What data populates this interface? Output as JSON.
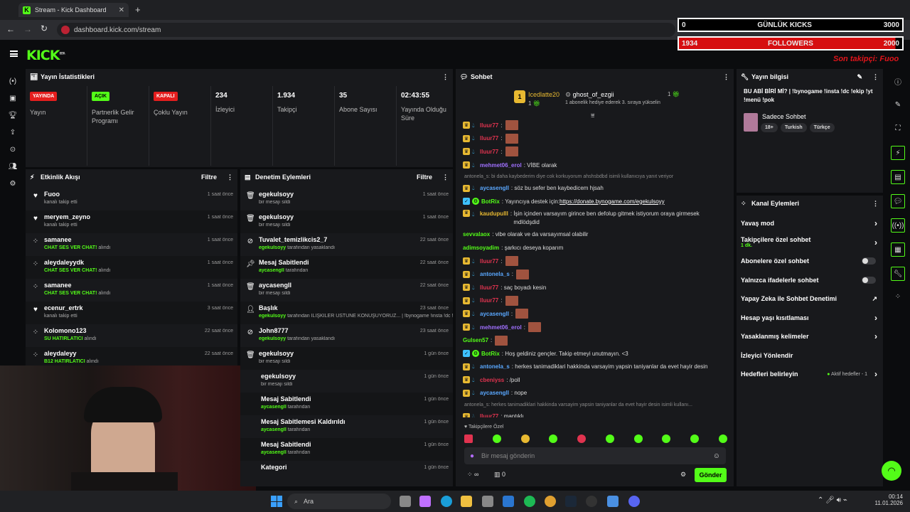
{
  "browser": {
    "tab_title": "Stream - Kick Dashboard",
    "url": "dashboard.kick.com/stream"
  },
  "brand": {
    "logo": "KICK",
    "logo_sup": "BETA",
    "accent": "#53fc18"
  },
  "overlay": {
    "kicks_left": "0",
    "kicks_label": "GÜNLÜK KICKS",
    "kicks_right": "3000",
    "followers_left": "1934",
    "followers_label": "FOLLOWERS",
    "followers_right": "2000",
    "last_follower": "Son takipçi: Fuoo"
  },
  "stats_panel": {
    "title": "Yayın İstatistikleri",
    "items": [
      {
        "badge": "YAYINDA",
        "label": "Yayın"
      },
      {
        "badge": "AÇIK",
        "label": "Partnerlik Gelir Programı"
      },
      {
        "badge": "KAPALI",
        "label": "Çoklu Yayın"
      },
      {
        "value": "234",
        "label": "İzleyici"
      },
      {
        "value": "1.934",
        "label": "Takipçi"
      },
      {
        "value": "35",
        "label": "Abone Sayısı"
      },
      {
        "value": "02:43:55",
        "label": "Yayında Olduğu Süre"
      }
    ]
  },
  "activity": {
    "title": "Etkinlik Akışı",
    "filter": "Filtre",
    "items": [
      {
        "icon": "heart-icon",
        "name": "Fuoo",
        "detail": "kanalı takip etti",
        "time": "1 saat önce"
      },
      {
        "icon": "heart-icon",
        "name": "meryem_zeyno",
        "detail": "kanalı takip etti",
        "time": "1 saat önce"
      },
      {
        "icon": "kicks-icon",
        "name": "samanee",
        "highlight": "CHAT SES VER CHAT!",
        "detail": "alındı",
        "time": "1 saat önce"
      },
      {
        "icon": "kicks-icon",
        "name": "aleydaleyydk",
        "highlight": "CHAT SES VER CHAT!",
        "detail": "alındı",
        "time": "1 saat önce"
      },
      {
        "icon": "kicks-icon",
        "name": "samanee",
        "highlight": "CHAT SES VER CHAT!",
        "detail": "alındı",
        "time": "1 saat önce"
      },
      {
        "icon": "heart-icon",
        "name": "ecenur_ertrk",
        "detail": "kanalı takip etti",
        "time": "3 saat önce"
      },
      {
        "icon": "kicks-icon",
        "name": "Kolomono123",
        "highlight": "SU HATIRLATICI",
        "detail": "alındı",
        "time": "22 saat önce"
      },
      {
        "icon": "kicks-icon",
        "name": "aleydaleyy",
        "highlight": "B12 HATIRLATICI",
        "detail": "alındı",
        "time": "22 saat önce"
      }
    ]
  },
  "moderation": {
    "title": "Denetim Eylemleri",
    "filter": "Filtre",
    "items": [
      {
        "icon": "trash-icon",
        "name": "egekulsoyy",
        "detail": "bir mesajı sildi",
        "time": "1 saat önce"
      },
      {
        "icon": "trash-icon",
        "name": "egekulsoyy",
        "detail": "bir mesajı sildi",
        "time": "1 saat önce"
      },
      {
        "icon": "ban-icon",
        "name": "Tuvalet_temizlikcis2_7",
        "highlight": "egekulsoyy",
        "detail": "tarafından yasaklandı",
        "time": "22 saat önce"
      },
      {
        "icon": "pin-icon",
        "name": "Mesaj Sabitlendi",
        "highlight": "aycasengll",
        "detail": "tarafından",
        "time": "22 saat önce"
      },
      {
        "icon": "trash-icon",
        "name": "aycasengll",
        "detail": "bir mesajı sildi",
        "time": "22 saat önce"
      },
      {
        "icon": "title-icon",
        "name": "Başlık",
        "highlight": "egekulsoyy",
        "detail": "tarafından İLİŞKİLER ÜSTÜNE KONUŞUYORUZ... | !bynogame !insta !dc !ekip !yt !menü !pok olarak değiştirildi",
        "time": "23 saat önce"
      },
      {
        "icon": "ban-icon",
        "name": "John8777",
        "highlight": "egekulsoyy",
        "detail": "tarafından yasaklandı",
        "time": "23 saat önce"
      },
      {
        "icon": "trash-icon",
        "name": "egekulsoyy",
        "detail": "bir mesajı sildi",
        "time": "1 gün önce"
      },
      {
        "icon": "",
        "name": "egekulsoyy",
        "detail": "bir mesajı sildi",
        "time": "1 gün önce"
      },
      {
        "icon": "",
        "name": "Mesaj Sabitlendi",
        "highlight": "aycasengll",
        "detail": "tarafından",
        "time": "1 gün önce"
      },
      {
        "icon": "",
        "name": "Mesaj Sabitlemesi Kaldırıldı",
        "highlight": "aycasengll",
        "detail": "tarafından",
        "time": "1 gün önce"
      },
      {
        "icon": "",
        "name": "Mesaj Sabitlendi",
        "highlight": "aycasengll",
        "detail": "tarafından",
        "time": "1 gün önce"
      },
      {
        "icon": "",
        "name": "Kategori",
        "detail": "",
        "time": "1 gün önce"
      }
    ]
  },
  "chat": {
    "title": "Sohbet",
    "top_gifter_1": "Icedlatte20",
    "top_gifter_1_count": "1",
    "top_gifter_2": "ghost_of_ezgii",
    "top_gifter_2_count": "1",
    "gift_note": "1 abonelik hediye ederek 3. sıraya yükselin",
    "messages": [
      {
        "user": "lluur77",
        "color": "#e0334f",
        "thumb": true,
        "text": ""
      },
      {
        "user": "lluur77",
        "color": "#e0334f",
        "thumb": true,
        "text": ""
      },
      {
        "user": "lluur77",
        "color": "#e0334f",
        "thumb": true,
        "text": ""
      },
      {
        "user": "mehmet06_erol",
        "color": "#a070ff",
        "text": "VİBE olarak"
      },
      {
        "reply": "antonela_s: bi daha kaybederim diye cok korkuyorum ahshsbdbd isimli kullanıcıya yanıt veriyor"
      },
      {
        "user": "aycasengll",
        "color": "#5aa8ff",
        "text": "söz bu sefer ben kaybedicem hjsah"
      },
      {
        "user": "BotRix",
        "color": "#53fc18",
        "text": "Yayıncıya destek için: ",
        "link": "https://donate.bynogame.com/egekulsoyy"
      },
      {
        "user": "kaudupulll",
        "color": "#e8b931",
        "text": "İşin içinden varsayım girince ben defolup gitmek istiyorum oraya girmesek mdlödşdid",
        "double": true
      },
      {
        "user": "sevvalaox",
        "color": "#53fc18",
        "text": "vibe olarak ve da varsayımsal olabilir"
      },
      {
        "user": "adimsoyadim",
        "color": "#53fc18",
        "text": "şarkıcı deseya koparım"
      },
      {
        "user": "lluur77",
        "color": "#e0334f",
        "thumb": true,
        "text": ""
      },
      {
        "user": "antonela_s",
        "color": "#5aa8ff",
        "thumb": true,
        "text": ""
      },
      {
        "user": "lluur77",
        "color": "#e0334f",
        "text": "saç boyadı kesin"
      },
      {
        "user": "lluur77",
        "color": "#e0334f",
        "thumb": true,
        "text": ""
      },
      {
        "user": "aycasengll",
        "color": "#5aa8ff",
        "thumb": true,
        "text": ""
      },
      {
        "user": "mehmet06_erol",
        "color": "#a070ff",
        "thumb": true,
        "text": ""
      },
      {
        "user": "Gulsen57",
        "color": "#53fc18",
        "thumb": true,
        "text": ""
      },
      {
        "user": "BotRix",
        "color": "#53fc18",
        "text": "Hoş geldiniz gençler. Takip etmeyi unutmayın. <3"
      },
      {
        "user": "antonela_s",
        "color": "#5aa8ff",
        "text": "herkes tanimadiklari hakkinda varsayim yapsin taniyanlar da evet hayir desin"
      },
      {
        "user": "cbeniyss",
        "color": "#e0334f",
        "text": "/poll"
      },
      {
        "user": "aycasengll",
        "color": "#5aa8ff",
        "text": "nope"
      },
      {
        "reply": "antonela_s: herkes tanimadiklari hakkinda varsayim yapsin taniyanlar da evet hayir desin isimli kullanı..."
      },
      {
        "user": "lluur77",
        "color": "#e0334f",
        "text": "mantıklı"
      }
    ],
    "followers_only": "Takipçilere Özel",
    "placeholder": "Bir mesaj gönderin",
    "viewer_count": "0",
    "send": "Gönder"
  },
  "stream_info": {
    "title": "Yayın bilgisi",
    "stream_title": "BU ABİ BİRİ Mİ? | !bynogame !insta !dc !ekip !yt !menü !pok",
    "category": "Sadece Sohbet",
    "tags": [
      "18+",
      "Turkish",
      "Türkçe"
    ]
  },
  "channel_actions": {
    "title": "Kanal Eylemleri",
    "rows": [
      {
        "label": "Yavaş mod",
        "control": "chevron"
      },
      {
        "label": "Takipçilere özel sohbet",
        "sub": "1 dk.",
        "control": "chevron"
      },
      {
        "label": "Abonelere özel sohbet",
        "control": "toggle"
      },
      {
        "label": "Yalnızca ifadelerle sohbet",
        "control": "toggle"
      },
      {
        "label": "Yapay Zeka ile Sohbet Denetimi",
        "control": "external"
      },
      {
        "label": "Hesap yaşı kısıtlaması",
        "control": "chevron"
      },
      {
        "label": "Yasaklanmış kelimeler",
        "control": "chevron"
      },
      {
        "label": "İzleyici Yönlendir",
        "control": ""
      },
      {
        "label": "Hedefleri belirleyin",
        "status": "Aktif hedefler - 1",
        "control": "chevron"
      }
    ]
  },
  "taskbar": {
    "search": "Ara",
    "time": "00:14",
    "date": "11.01.2026"
  }
}
